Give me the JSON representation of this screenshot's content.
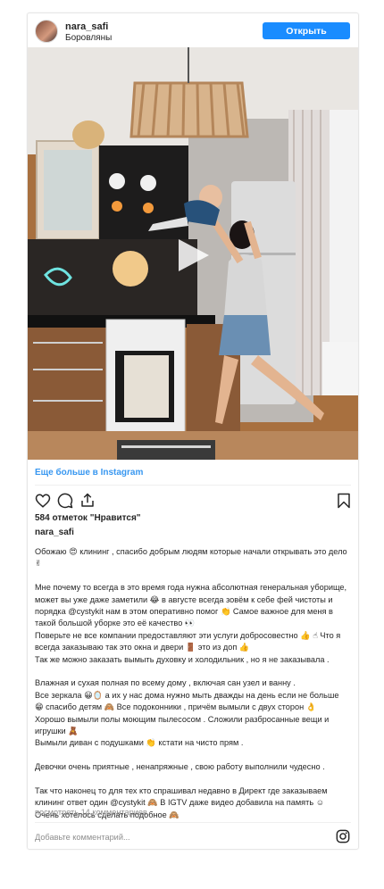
{
  "header": {
    "username": "nara_safi",
    "location": "Боровляны",
    "profile_button": "Открыть профиль"
  },
  "media": {
    "type": "video",
    "icons": [
      "play-icon"
    ]
  },
  "more_link": "Еще больше в Instagram",
  "actions": {
    "icons": [
      "heart-icon",
      "comment-icon",
      "share-icon",
      "bookmark-icon"
    ]
  },
  "likes": "584 отметок \"Нравится\"",
  "author": "nara_safi",
  "caption": [
    "Обожаю 😍 клининг , спасибо добрым людям которые начали открывать это дело ✌",
    "Мне почему то всегда в это время года нужна абсолютная генеральная уборище, может вы уже даже заметили 😂 в августе всегда зовём к себе фей чистоты и порядка @cystykit нам в этом оперативно помог 👏 Самое важное для меня в такой большой уборке это её качество 👀\nПоверьте не все компании предоставляют эти услуги добросовестно 👍 ☝ Что я всегда заказываю так это окна и двери 🚪 это из доп 👍\nТак же можно заказать вымыть духовку и холодильник , но я не заказывала .",
    "Влажная и сухая полная по всему дому , включая сан узел и ванну .\nВсе зеркала 😀🪞 а их у нас дома нужно мыть дважды на день если не больше 😁 спасибо детям 🙈 Все подоконники , причём вымыли с двух сторон 👌\nХорошо вымыли полы моющим пылесосом . Сложили разбросанные вещи и игрушки 🧸\nВымыли диван с подушками 👏 кстати на чисто прям .",
    "Девочки очень приятные , ненапряжные , свою работу выполнили чудесно .",
    "Так что наконец то для тех кто спрашивал недавно в Директ где заказываем клининг ответ один @cystykit 🙈 В IGTV даже видео добавила на память ☺\nОчень хотелось сделать подобное 🙈"
  ],
  "comments_link": "посмотреть 14 комментариев",
  "comment_placeholder": "Добавьте комментарий...",
  "footer_icon": "instagram-icon",
  "colors": {
    "accent": "#1a8cff",
    "link": "#3897f0",
    "muted": "#8e8e8e",
    "text": "#262626"
  }
}
